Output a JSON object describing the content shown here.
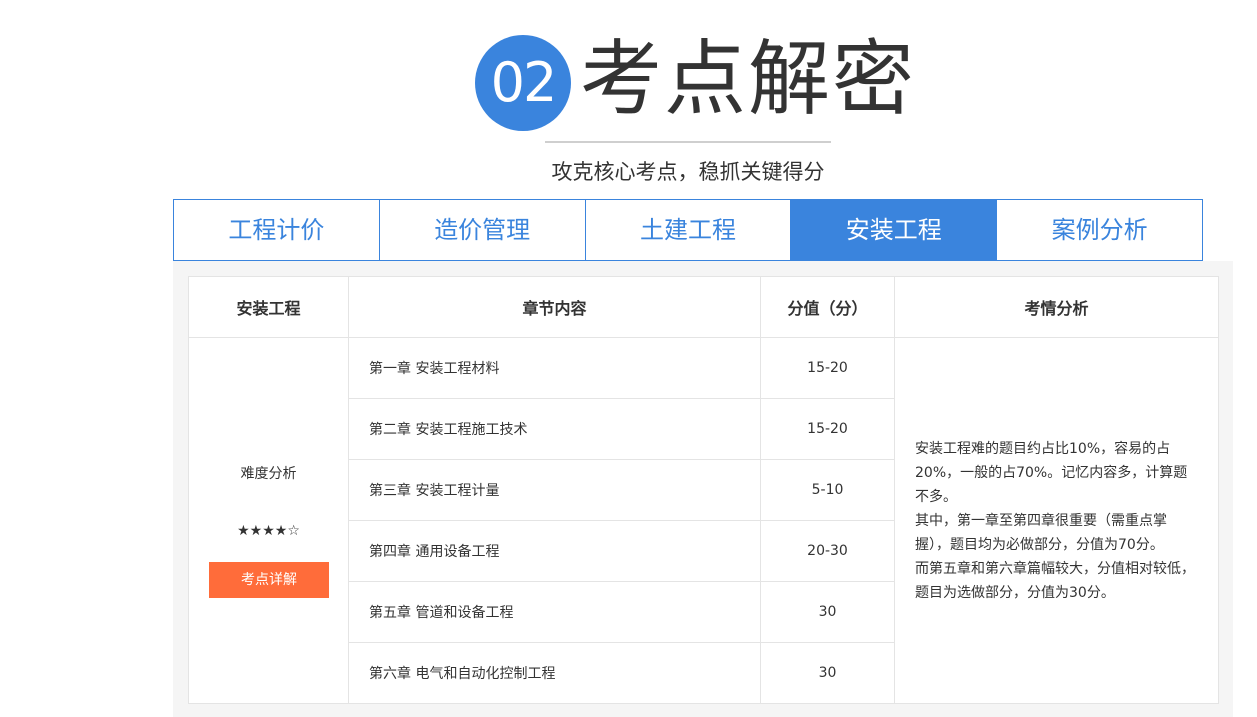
{
  "header": {
    "number": "02",
    "title": "考点解密",
    "subtitle": "攻克核心考点，稳抓关键得分"
  },
  "tabs": [
    {
      "label": "工程计价",
      "active": false
    },
    {
      "label": "造价管理",
      "active": false
    },
    {
      "label": "土建工程",
      "active": false
    },
    {
      "label": "安装工程",
      "active": true
    },
    {
      "label": "案例分析",
      "active": false
    }
  ],
  "table": {
    "headers": [
      "安装工程",
      "章节内容",
      "分值（分）",
      "考情分析"
    ],
    "difficulty_label": "难度分析",
    "difficulty_stars": "★★★★☆",
    "detail_button": "考点详解",
    "rows": [
      {
        "chapter": "第一章 安装工程材料",
        "score": "15-20"
      },
      {
        "chapter": "第二章 安装工程施工技术",
        "score": "15-20"
      },
      {
        "chapter": "第三章 安装工程计量",
        "score": "5-10"
      },
      {
        "chapter": "第四章 通用设备工程",
        "score": "20-30"
      },
      {
        "chapter": "第五章 管道和设备工程",
        "score": "30"
      },
      {
        "chapter": "第六章 电气和自动化控制工程",
        "score": "30"
      }
    ],
    "analysis": [
      "安装工程难的题目约占比10%，容易的占20%，一般的占70%。记忆内容多，计算题不多。",
      "其中，第一章至第四章很重要（需重点掌握），题目均为必做部分，分值为70分。",
      "而第五章和第六章篇幅较大，分值相对较低，题目为选做部分，分值为30分。"
    ]
  },
  "colors": {
    "accent_blue": "#3a84dd",
    "button_orange": "#ff6c3a",
    "panel_bg": "#f5f5f5",
    "border": "#e4e4e4"
  }
}
